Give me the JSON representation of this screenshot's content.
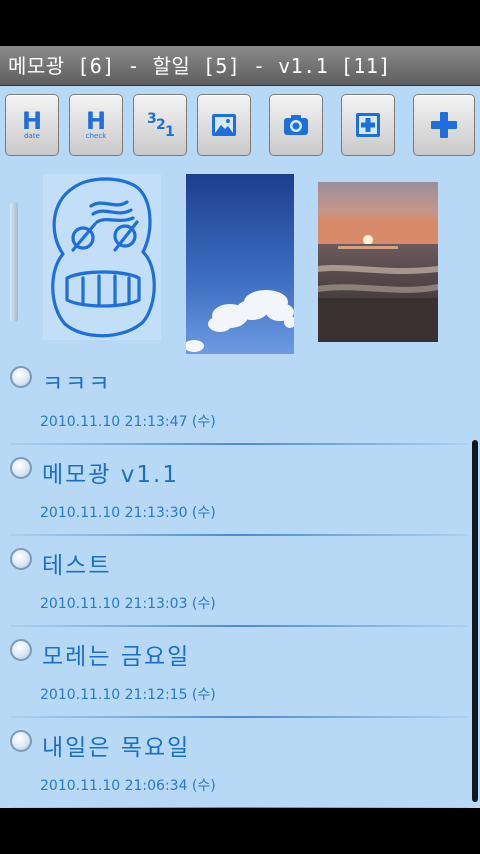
{
  "window": {
    "title": "메모광 [6] - 할일 [5] - v1.1 [11]"
  },
  "toolbar": {
    "buttons": [
      {
        "name": "sort-by-date-button",
        "glyph": "H",
        "sub": "date"
      },
      {
        "name": "sort-by-check-button",
        "glyph": "H",
        "sub": "check"
      },
      {
        "name": "sort-order-button",
        "glyph": "321",
        "sub": ""
      },
      {
        "name": "image-button",
        "icon": "image-icon"
      },
      {
        "name": "camera-button",
        "icon": "camera-icon"
      },
      {
        "name": "add-item-button",
        "icon": "plus-box-icon"
      },
      {
        "name": "add-memo-button",
        "icon": "plus-icon"
      }
    ]
  },
  "gallery": {
    "thumbs": [
      {
        "name": "drawing-thumbnail",
        "icon": "drawing-icon"
      },
      {
        "name": "sky-photo-thumbnail",
        "icon": "sky-photo"
      },
      {
        "name": "sunset-photo-thumbnail",
        "icon": "sunset-photo"
      }
    ]
  },
  "memos": [
    {
      "title": "ㅋㅋㅋ",
      "date": "2010.11.10 21:13:47 (수)"
    },
    {
      "title": "메모광 v1.1",
      "date": "2010.11.10 21:13:30 (수)"
    },
    {
      "title": "테스트",
      "date": "2010.11.10 21:13:03 (수)"
    },
    {
      "title": "모레는 금요일",
      "date": "2010.11.10 21:12:15 (수)"
    },
    {
      "title": "내일은 목요일",
      "date": "2010.11.10 21:06:34 (수)"
    }
  ],
  "colors": {
    "background": "#b7d9f5",
    "accent": "#1e6fd9",
    "text": "#1d6fc6"
  }
}
